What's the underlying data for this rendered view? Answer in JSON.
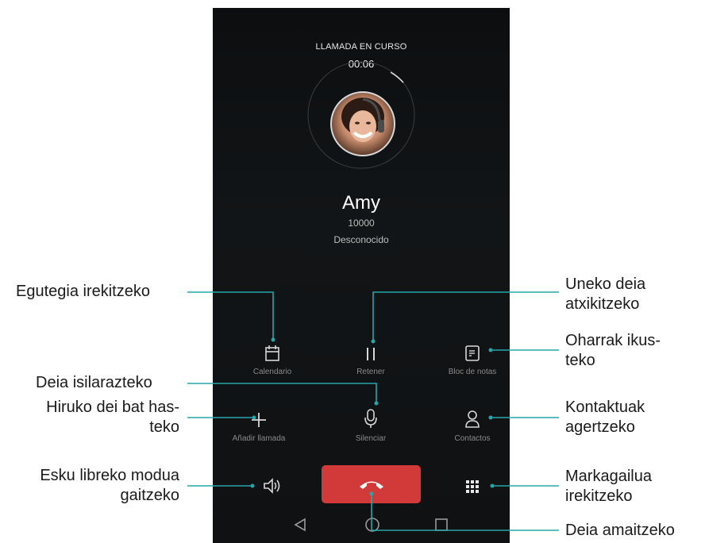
{
  "call": {
    "status": "LLAMADA EN CURSO",
    "timer": "00:06",
    "contact_name": "Amy",
    "contact_number": "10000",
    "contact_location": "Desconocido"
  },
  "controls": {
    "calendar": "Calendario",
    "hold": "Retener",
    "notes": "Bloc de notas",
    "add_call": "Añadir llamada",
    "mute": "Silenciar",
    "contacts": "Contactos"
  },
  "annotations": {
    "calendar": "Egutegia irekitzeko",
    "hold_line1": "Uneko deia",
    "hold_line2": "atxikitzeko",
    "notes_line1": "Oharrak ikus-",
    "notes_line2": "teko",
    "mute": "Deia isilarazteko",
    "add_call_line1": "Hiruko dei bat has-",
    "add_call_line2": "teko",
    "contacts_line1": "Kontaktuak",
    "contacts_line2": "agertzeko",
    "speaker_line1": "Esku libreko modua",
    "speaker_line2": "gaitzeko",
    "dialpad_line1": "Markagailua",
    "dialpad_line2": "irekitzeko",
    "end_call": "Deia amaitzeko"
  },
  "colors": {
    "accent_teal": "#27a6a9",
    "end_call_red": "#d23a3a",
    "screen_bg": "#111315"
  },
  "icons": [
    "calendar-icon",
    "pause-icon",
    "notes-icon",
    "plus-icon",
    "microphone-icon",
    "contact-icon",
    "speaker-icon",
    "dialpad-icon",
    "phone-hangup-icon",
    "back-icon",
    "home-icon",
    "recent-apps-icon"
  ]
}
